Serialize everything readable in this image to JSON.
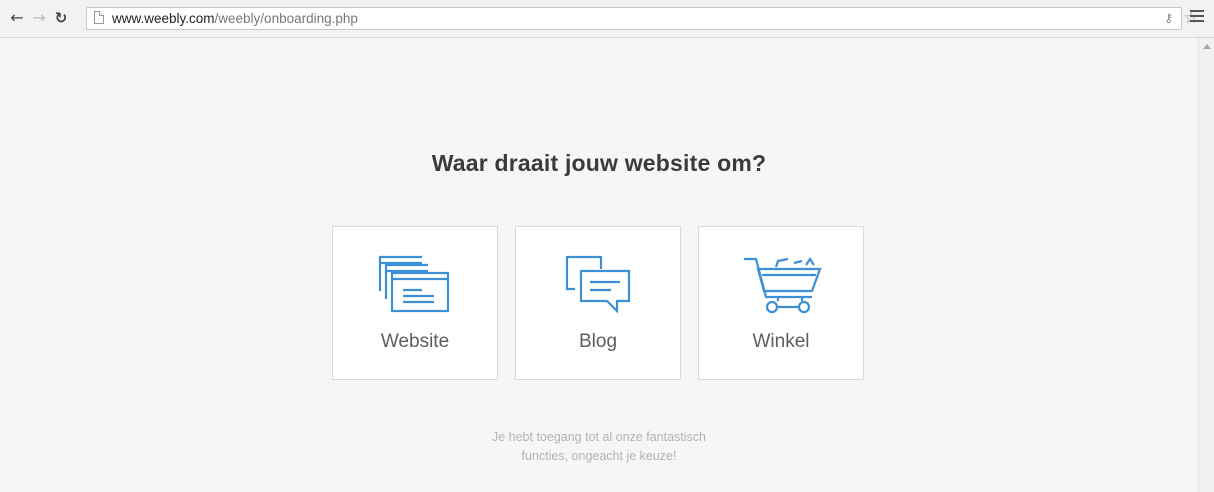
{
  "browser": {
    "url_host": "www.weebly.com",
    "url_path": "/weebly/onboarding.php",
    "icons": [
      "back-arrow-icon",
      "forward-arrow-icon",
      "reload-icon",
      "page-icon",
      "key-icon",
      "star-icon",
      "menu-icon"
    ]
  },
  "main": {
    "heading": "Waar draait jouw website om?",
    "options": [
      {
        "label": "Website",
        "icon": "website-icon"
      },
      {
        "label": "Blog",
        "icon": "blog-icon"
      },
      {
        "label": "Winkel",
        "icon": "shopping-cart-icon"
      }
    ],
    "note_line1": "Je hebt toegang tot al onze fantastisch",
    "note_line2": "functies, ongeacht je keuze!"
  },
  "colors": {
    "accent": "#3d8fd6",
    "page_background": "#f6f6f6",
    "heading": "#3b3b3b",
    "note": "#b3b3b3"
  }
}
